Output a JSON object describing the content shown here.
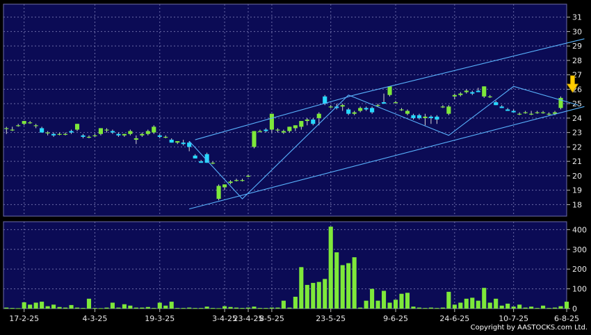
{
  "copyright": "Copyright by AASTOCKS.com Ltd.",
  "colors": {
    "background": "#0b0b55",
    "up": "#7ee83a",
    "down": "#27d8ff",
    "trendline": "#5ab4ff",
    "arrow": "#ffcc00",
    "tick": "#e8e8e8"
  },
  "chart_data": [
    {
      "type": "candlestick",
      "ylim": [
        17.2,
        31.9
      ],
      "y_ticks": [
        18,
        19,
        20,
        21,
        22,
        23,
        24,
        25,
        26,
        27,
        28,
        29,
        30,
        31
      ],
      "x_tick_labels": [
        "17-2-25",
        "4-3-25",
        "19-3-25",
        "3-4-25",
        "23-4-25",
        "8-5-25",
        "23-5-25",
        "9-6-25",
        "24-6-25",
        "10-7-25",
        "6-8-25"
      ],
      "x_tick_index": [
        3,
        15,
        26,
        37,
        41,
        45,
        55,
        66,
        76,
        86,
        95
      ],
      "grid": true,
      "candles": [
        [
          23.3,
          23.4,
          22.9,
          23.3
        ],
        [
          23.2,
          23.4,
          23.1,
          23.2
        ],
        [
          23.5,
          23.6,
          23.4,
          23.5
        ],
        [
          23.6,
          23.8,
          23.5,
          23.8
        ],
        [
          23.7,
          23.8,
          23.6,
          23.7
        ],
        [
          23.5,
          23.6,
          23.3,
          23.5
        ],
        [
          23.3,
          23.4,
          23.0,
          23.0
        ],
        [
          23.0,
          23.1,
          22.8,
          23.0
        ],
        [
          22.9,
          23.0,
          22.7,
          22.8
        ],
        [
          22.9,
          23.0,
          22.8,
          22.9
        ],
        [
          22.9,
          23.0,
          22.8,
          22.9
        ],
        [
          23.1,
          23.2,
          22.9,
          23.0
        ],
        [
          23.2,
          23.6,
          23.1,
          23.6
        ],
        [
          22.8,
          22.9,
          22.6,
          22.7
        ],
        [
          22.7,
          22.8,
          22.6,
          22.7
        ],
        [
          22.8,
          22.9,
          22.7,
          22.8
        ],
        [
          22.9,
          23.3,
          22.8,
          23.3
        ],
        [
          23.2,
          23.3,
          23.0,
          23.2
        ],
        [
          23.1,
          23.2,
          22.9,
          23.0
        ],
        [
          22.9,
          23.0,
          22.7,
          22.8
        ],
        [
          22.8,
          22.9,
          22.7,
          22.9
        ],
        [
          22.9,
          23.2,
          22.8,
          23.1
        ],
        [
          22.5,
          22.8,
          22.2,
          22.6
        ],
        [
          22.8,
          23.0,
          22.7,
          22.9
        ],
        [
          22.9,
          23.2,
          22.8,
          23.1
        ],
        [
          23.0,
          23.5,
          22.9,
          23.4
        ],
        [
          22.8,
          22.9,
          22.6,
          22.7
        ],
        [
          22.7,
          22.8,
          22.6,
          22.7
        ],
        [
          22.5,
          22.6,
          22.3,
          22.3
        ],
        [
          22.3,
          22.4,
          22.2,
          22.4
        ],
        [
          22.3,
          22.5,
          22.1,
          22.2
        ],
        [
          22.3,
          22.4,
          21.7,
          22.0
        ],
        [
          21.4,
          21.5,
          21.2,
          21.2
        ],
        [
          21.0,
          21.1,
          20.9,
          20.9
        ],
        [
          21.5,
          21.6,
          20.9,
          20.9
        ],
        [
          20.9,
          21.0,
          20.8,
          20.9
        ],
        [
          18.4,
          19.4,
          18.3,
          19.3
        ],
        [
          19.2,
          19.4,
          19.0,
          19.4
        ],
        [
          19.5,
          19.7,
          19.4,
          19.6
        ],
        [
          19.7,
          19.8,
          19.6,
          19.7
        ],
        [
          19.7,
          19.8,
          19.6,
          19.7
        ],
        [
          20.0,
          20.1,
          19.9,
          20.0
        ],
        [
          22.0,
          23.1,
          21.9,
          23.1
        ],
        [
          23.1,
          23.2,
          23.0,
          23.1
        ],
        [
          23.2,
          23.3,
          23.0,
          23.1
        ],
        [
          23.2,
          24.3,
          23.0,
          24.3
        ],
        [
          23.2,
          23.3,
          23.0,
          23.2
        ],
        [
          23.0,
          23.2,
          22.9,
          23.1
        ],
        [
          23.1,
          23.4,
          23.0,
          23.4
        ],
        [
          23.3,
          23.5,
          23.1,
          23.5
        ],
        [
          23.4,
          23.8,
          23.2,
          23.8
        ],
        [
          23.8,
          24.0,
          23.5,
          23.9
        ],
        [
          23.9,
          24.0,
          23.5,
          23.6
        ],
        [
          24.0,
          24.4,
          23.5,
          24.3
        ],
        [
          25.5,
          25.6,
          24.9,
          25.0
        ],
        [
          24.8,
          24.9,
          24.7,
          24.8
        ],
        [
          24.8,
          25.0,
          24.6,
          24.7
        ],
        [
          24.8,
          25.0,
          24.5,
          24.9
        ],
        [
          24.6,
          24.7,
          24.2,
          24.3
        ],
        [
          24.3,
          24.5,
          24.2,
          24.4
        ],
        [
          24.5,
          24.8,
          24.4,
          24.7
        ],
        [
          24.7,
          24.8,
          24.5,
          24.6
        ],
        [
          24.7,
          24.8,
          24.3,
          24.4
        ],
        [
          24.9,
          25.0,
          24.8,
          24.9
        ],
        [
          25.1,
          25.7,
          25.0,
          25.0
        ],
        [
          25.6,
          26.2,
          25.5,
          26.2
        ],
        [
          25.1,
          25.2,
          25.0,
          25.1
        ],
        [
          24.6,
          24.7,
          24.5,
          24.6
        ],
        [
          24.3,
          24.6,
          24.2,
          24.5
        ],
        [
          24.2,
          24.3,
          23.9,
          24.0
        ],
        [
          24.2,
          24.3,
          23.9,
          24.0
        ],
        [
          24.0,
          24.3,
          23.5,
          24.1
        ],
        [
          24.1,
          24.2,
          23.6,
          24.0
        ],
        [
          24.1,
          24.2,
          23.6,
          23.9
        ],
        [
          24.8,
          24.9,
          24.7,
          24.8
        ],
        [
          24.3,
          24.9,
          24.2,
          24.8
        ],
        [
          25.5,
          25.7,
          25.3,
          25.6
        ],
        [
          25.6,
          25.8,
          25.5,
          25.7
        ],
        [
          25.8,
          26.0,
          25.7,
          25.9
        ],
        [
          25.8,
          25.9,
          25.6,
          25.7
        ],
        [
          25.9,
          26.1,
          25.8,
          25.8
        ],
        [
          25.5,
          26.2,
          25.4,
          26.2
        ],
        [
          25.5,
          25.6,
          25.4,
          25.5
        ],
        [
          25.1,
          25.2,
          24.9,
          24.9
        ],
        [
          24.8,
          24.9,
          24.7,
          24.7
        ],
        [
          24.6,
          24.7,
          24.5,
          24.5
        ],
        [
          24.5,
          24.6,
          24.4,
          24.4
        ],
        [
          24.3,
          24.4,
          24.2,
          24.3
        ],
        [
          24.4,
          24.5,
          24.3,
          24.4
        ],
        [
          24.3,
          24.5,
          24.2,
          24.3
        ],
        [
          24.4,
          24.5,
          24.3,
          24.4
        ],
        [
          24.4,
          24.5,
          24.3,
          24.4
        ],
        [
          24.3,
          24.4,
          24.2,
          24.3
        ],
        [
          24.3,
          24.5,
          24.2,
          24.4
        ],
        [
          24.7,
          25.5,
          24.6,
          25.4
        ]
      ],
      "trendlines": [
        [
          [
            32,
            22.5
          ],
          [
            59,
            25.6
          ],
          [
            98,
            29.5
          ]
        ],
        [
          [
            31,
            17.7
          ],
          [
            98,
            24.8
          ]
        ],
        [
          [
            31,
            22.4
          ],
          [
            40,
            18.4
          ],
          [
            58,
            25.6
          ],
          [
            75,
            22.8
          ],
          [
            86,
            26.2
          ],
          [
            97,
            24.9
          ]
        ]
      ],
      "marker": {
        "index": 96,
        "value": 25.4,
        "shape": "down-arrow"
      }
    },
    {
      "type": "bar",
      "ylim": [
        0,
        440
      ],
      "y_ticks": [
        0,
        100,
        200,
        300,
        400
      ],
      "values": [
        5,
        3,
        2,
        32,
        20,
        30,
        35,
        12,
        20,
        8,
        5,
        18,
        5,
        3,
        50,
        3,
        2,
        5,
        30,
        5,
        22,
        15,
        5,
        5,
        8,
        3,
        30,
        15,
        35,
        3,
        3,
        5,
        3,
        3,
        10,
        3,
        2,
        12,
        8,
        5,
        3,
        5,
        10,
        3,
        3,
        5,
        5,
        40,
        5,
        60,
        210,
        120,
        130,
        135,
        150,
        415,
        285,
        220,
        230,
        260,
        5,
        40,
        100,
        40,
        90,
        30,
        45,
        75,
        80,
        10,
        5,
        3,
        5,
        3,
        5,
        85,
        20,
        30,
        50,
        55,
        40,
        105,
        30,
        50,
        15,
        25,
        10,
        20,
        5,
        10,
        3,
        15,
        3,
        5,
        12,
        35
      ]
    }
  ]
}
